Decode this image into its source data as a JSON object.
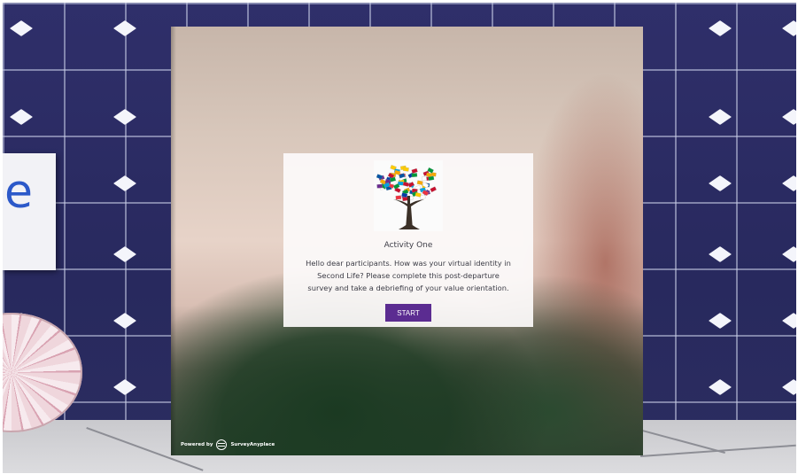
{
  "survey": {
    "title": "Activity One",
    "lines": [
      "Hello dear participants. How was your virtual identity in",
      "Second Life? Please complete this post-departure",
      "survey and take a debriefing of your value orientation."
    ],
    "start_label": "START",
    "accent_color": "#5b2c91"
  },
  "footer": {
    "powered_by": "Powered by",
    "brand": "SurveyAnyplace"
  },
  "environment": {
    "sign_text": "e",
    "wall_color": "#2b2c63"
  },
  "icons": {
    "logo": "flag-tree-icon",
    "brand_logo": "surveyanyplace-logo-icon"
  }
}
